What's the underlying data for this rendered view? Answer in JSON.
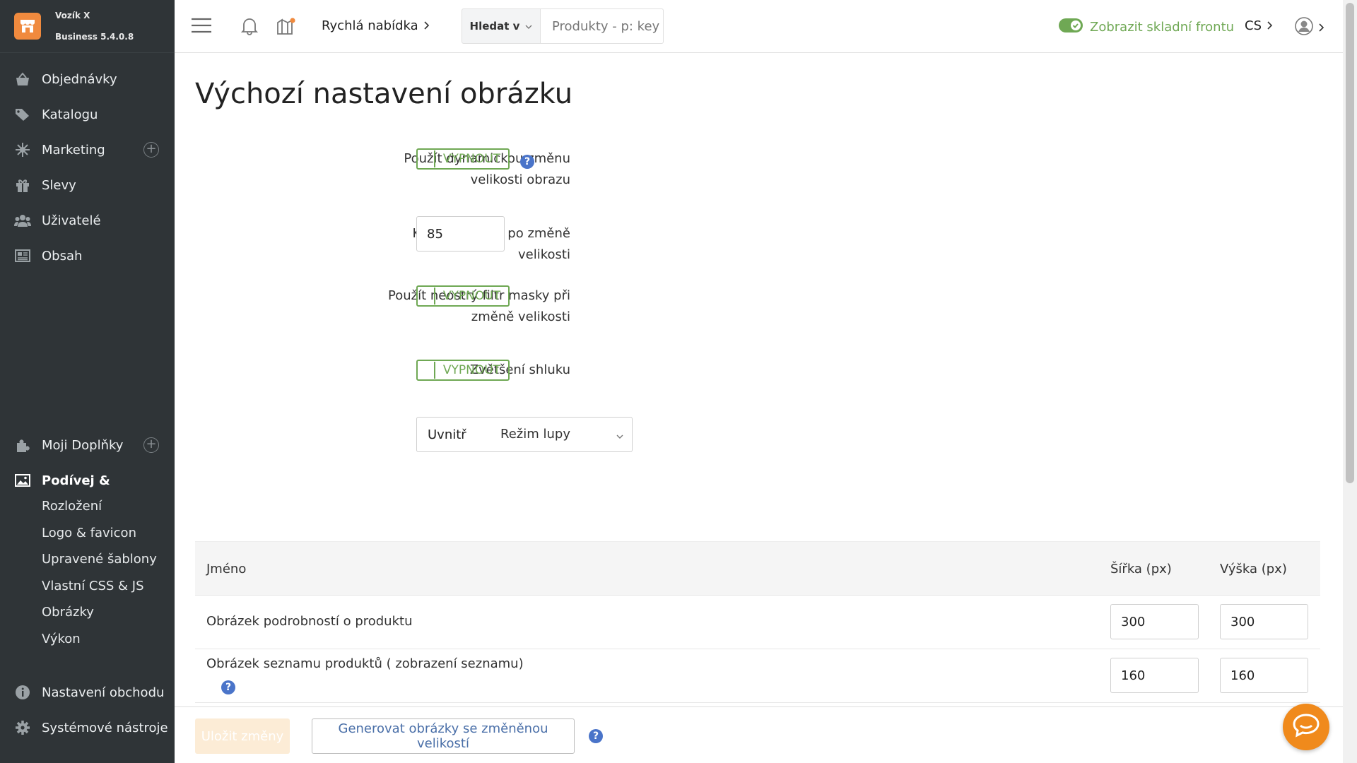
{
  "brand": {
    "name": "Vozík X",
    "version": "Business 5.4.0.8"
  },
  "sidebar": {
    "items": [
      {
        "label": "Objednávky",
        "icon": "cart-icon"
      },
      {
        "label": "Katalogu",
        "icon": "tags-icon"
      },
      {
        "label": "Marketing",
        "icon": "network-icon"
      },
      {
        "label": "Slevy",
        "icon": "gift-icon"
      },
      {
        "label": "Uživatelé",
        "icon": "users-icon"
      },
      {
        "label": "Obsah",
        "icon": "newspaper-icon"
      }
    ],
    "addons": {
      "label": "Moji Doplňky",
      "icon": "puzzle-icon"
    },
    "design": {
      "label": "Podívej &",
      "icon": "image-icon",
      "subitems": [
        "Rozložení",
        "Logo & favicon",
        "Upravené šablony",
        "Vlastní CSS & JS",
        "Obrázky",
        "Výkon"
      ]
    },
    "settings": {
      "label": "Nastavení obchodu",
      "icon": "info-icon"
    },
    "tools": {
      "label": "Systémové nástroje",
      "icon": "gear-icon"
    }
  },
  "topbar": {
    "quick_menu": "Rychlá nabídka",
    "search_scope": "Hledat v",
    "search_placeholder": "Produkty - p: key",
    "storefront_toggle": "Zobrazit skladní frontu",
    "language": "CS"
  },
  "page": {
    "title": "Výchozí nastavení obrázku",
    "fields": {
      "dynamic_resize_label": "Použít dynamickou změnu velikosti obrazu",
      "dynamic_resize_value": "VYPNOUT",
      "quality_label": "Kvalita obrazu po změně velikosti",
      "quality_value": "85",
      "unsharp_label": "Použít neostrý filtr masky při změně velikosti",
      "unsharp_value": "VYPNOUT",
      "cluster_label": "Zvětšení shluku",
      "cluster_value": "VYPNOUT",
      "zoom_label": "Režim lupy",
      "zoom_value": "Uvnitř"
    }
  },
  "table": {
    "headers": {
      "name": "Jméno",
      "width": "Šířka (px)",
      "height": "Výška (px)"
    },
    "rows": [
      {
        "name": "Obrázek podrobností o produktu",
        "width": "300",
        "height": "300"
      },
      {
        "name": "Obrázek seznamu produktů ( zobrazení seznamu)",
        "width": "160",
        "height": "160"
      }
    ]
  },
  "footer": {
    "save": "Uložit změny",
    "generate": "Generovat obrázky se změněnou velikostí"
  },
  "colors": {
    "accent_green": "#6fa854",
    "brand_orange": "#f08a3e",
    "sidebar_bg": "#2f3437",
    "help_blue": "#4a74c9"
  }
}
